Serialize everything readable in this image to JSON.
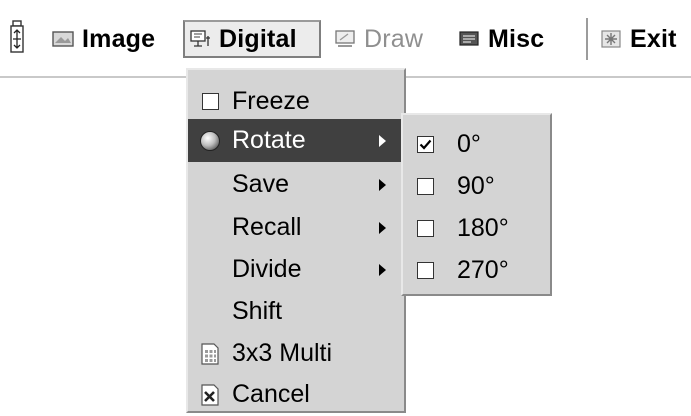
{
  "menubar": {
    "items": [
      {
        "label": "Image",
        "icon": "image-icon"
      },
      {
        "label": "Digital",
        "icon": "digital-icon"
      },
      {
        "label": "Draw",
        "icon": "draw-icon"
      },
      {
        "label": "Misc",
        "icon": "misc-icon"
      },
      {
        "label": "Exit",
        "icon": "exit-icon"
      }
    ]
  },
  "digital_menu": {
    "items": [
      {
        "label": "Freeze",
        "lead": "checkbox",
        "checked": false
      },
      {
        "label": "Rotate",
        "lead": "sphere-icon",
        "submenu": true,
        "selected": true
      },
      {
        "label": "Save",
        "submenu": true
      },
      {
        "label": "Recall",
        "submenu": true
      },
      {
        "label": "Divide",
        "submenu": true
      },
      {
        "label": "Shift"
      },
      {
        "label": "3x3 Multi",
        "lead": "grid-icon"
      },
      {
        "label": "Cancel",
        "lead": "cancel-icon"
      }
    ]
  },
  "rotate_menu": {
    "items": [
      {
        "label": "0°",
        "checked": true
      },
      {
        "label": "90°",
        "checked": false
      },
      {
        "label": "180°",
        "checked": false
      },
      {
        "label": "270°",
        "checked": false
      }
    ]
  },
  "colors": {
    "menu_bg": "#d4d4d4",
    "highlight_bg": "#404040",
    "highlight_text": "#ffffff",
    "disabled_text": "#8f8f8f"
  }
}
